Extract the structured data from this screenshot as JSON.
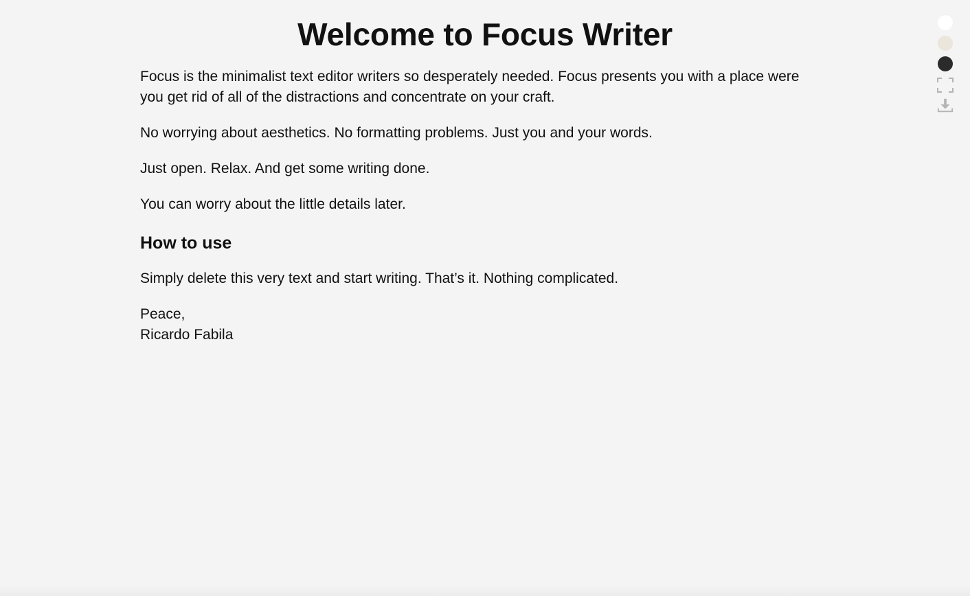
{
  "document": {
    "title": "Welcome to Focus Writer",
    "paragraphs": [
      "Focus is the minimalist text editor writers so desperately needed. Focus presents you with a place were you get rid of all of the distractions and concentrate on your craft.",
      "No worrying about aesthetics. No formatting problems. Just you and your words.",
      "Just open. Relax. And get some writing done.",
      "You can worry about the little details later."
    ],
    "heading": "How to use",
    "instruction": "Simply delete this very text and start writing. That’s it. Nothing complicated.",
    "signoff_line1": "Peace,",
    "signoff_line2": "Ricardo Fabila"
  },
  "controls": {
    "themes": [
      {
        "name": "white-theme",
        "color": "#ffffff"
      },
      {
        "name": "sepia-theme",
        "color": "#ebe6dc"
      },
      {
        "name": "dark-theme",
        "color": "#2b2b2b"
      }
    ],
    "icons": [
      "fullscreen-icon",
      "download-icon"
    ],
    "icon_color": "#b4b4b4"
  },
  "colors": {
    "background": "#f4f4f4",
    "text": "#111111"
  }
}
